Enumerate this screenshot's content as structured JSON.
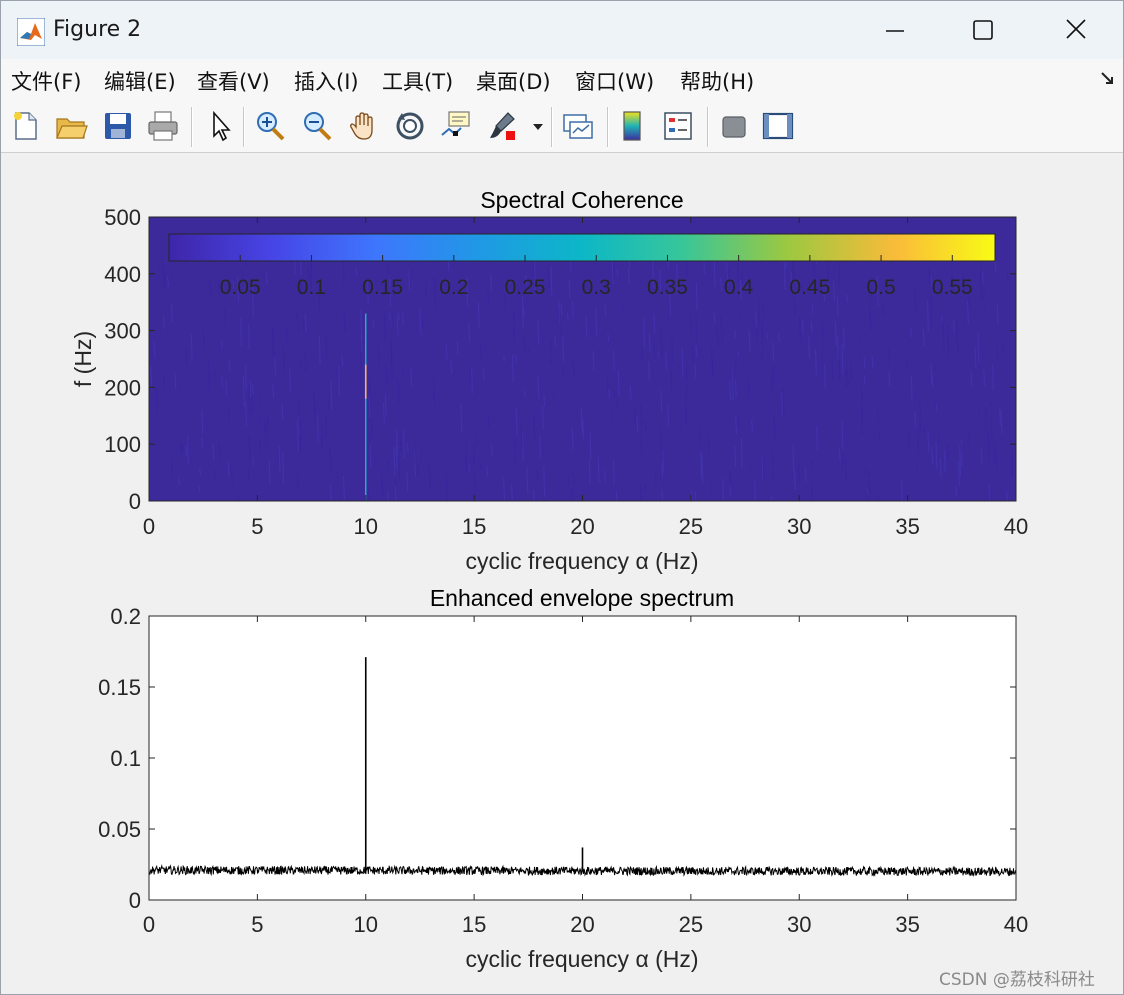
{
  "window": {
    "title": "Figure 2"
  },
  "menu": [
    "文件(F)",
    "编辑(E)",
    "查看(V)",
    "插入(I)",
    "工具(T)",
    "桌面(D)",
    "窗口(W)",
    "帮助(H)"
  ],
  "toolbar_icons": [
    "new-figure-icon",
    "open-file-icon",
    "save-icon",
    "print-icon",
    "pointer-icon",
    "zoom-in-icon",
    "zoom-out-icon",
    "pan-icon",
    "rotate-3d-icon",
    "data-cursor-icon",
    "brush-icon",
    "brush-dropdown-icon",
    "link-plot-icon",
    "colorbar-icon",
    "legend-icon",
    "hide-plot-tools-icon",
    "show-plot-tools-icon"
  ],
  "chart_data": [
    {
      "type": "heatmap",
      "title": "Spectral Coherence",
      "xlabel": "cyclic frequency α (Hz)",
      "ylabel": "f (Hz)",
      "xlim": [
        0,
        40
      ],
      "ylim": [
        0,
        500
      ],
      "xticks": [
        0,
        5,
        10,
        15,
        20,
        25,
        30,
        35,
        40
      ],
      "yticks": [
        0,
        100,
        200,
        300,
        400,
        500
      ],
      "colorbar": {
        "location": "northoutside (inside axes, top)",
        "colormap": "parula",
        "ticks": [
          "0.05",
          "0.1",
          "0.15",
          "0.2",
          "0.25",
          "0.3",
          "0.35",
          "0.4",
          "0.45",
          "0.5",
          "0.55"
        ],
        "range": [
          0.0,
          0.58
        ]
      },
      "background_value": 0.01,
      "features": [
        {
          "alpha": 10,
          "f_range": [
            0,
            330
          ],
          "value_peak": 0.45,
          "peak_f": 200
        }
      ]
    },
    {
      "type": "line",
      "title": "Enhanced envelope spectrum",
      "xlabel": "cyclic frequency α (Hz)",
      "ylabel": "",
      "xlim": [
        0,
        40
      ],
      "ylim": [
        0,
        0.2
      ],
      "xticks": [
        0,
        5,
        10,
        15,
        20,
        25,
        30,
        35,
        40
      ],
      "yticks": [
        "0",
        "0.05",
        "0.1",
        "0.15",
        "0.2"
      ],
      "baseline": 0.02,
      "peaks": [
        {
          "x": 10,
          "y": 0.171
        },
        {
          "x": 20,
          "y": 0.037
        }
      ]
    }
  ],
  "watermark": "CSDN @荔枝科研社"
}
